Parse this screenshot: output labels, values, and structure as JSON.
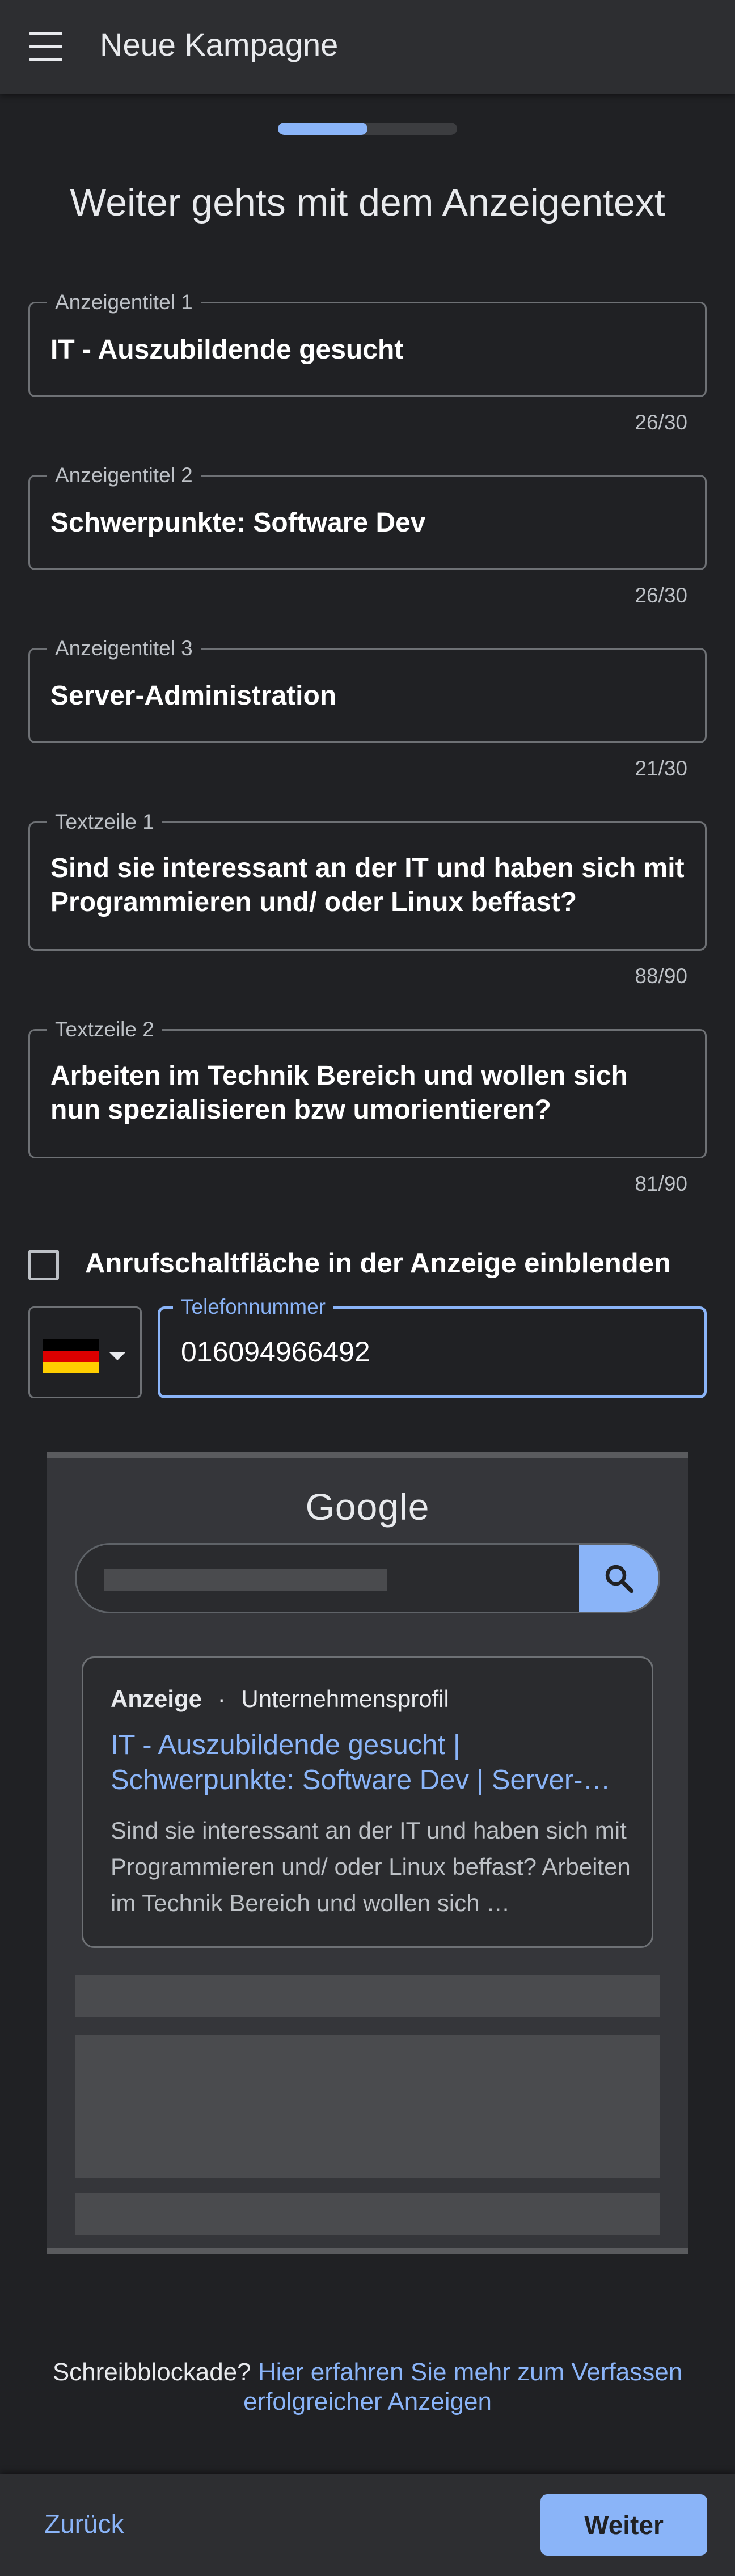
{
  "appbar": {
    "title": "Neue Kampagne",
    "menu_icon": "hamburger-menu-icon"
  },
  "progress": {
    "fraction": 0.5
  },
  "heading": "Weiter gehts mit dem Anzeigentext",
  "fields": [
    {
      "label": "Anzeigentitel 1",
      "value": "IT - Auszubildende gesucht",
      "counter": "26/30"
    },
    {
      "label": "Anzeigentitel 2",
      "value": "Schwerpunkte: Software Dev",
      "counter": "26/30"
    },
    {
      "label": "Anzeigentitel 3",
      "value": "Server-Administration",
      "counter": "21/30"
    },
    {
      "label": "Textzeile 1",
      "value": "Sind sie interessant an der IT und haben sich mit Programmieren und/ oder Linux beffast?",
      "counter": "88/90"
    },
    {
      "label": "Textzeile 2",
      "value": "Arbeiten im Technik Bereich und wollen sich nun spezialisieren bzw umorientieren?",
      "counter": "81/90"
    }
  ],
  "call_button": {
    "label": "Anrufschaltfläche in der Anzeige einblenden",
    "checked": false
  },
  "phone": {
    "country": "DE",
    "label": "Telefonnummer",
    "value": "016094966492"
  },
  "preview": {
    "logo": "Google",
    "search_icon": "search-icon",
    "ad_label": "Anzeige",
    "ad_separator": "·",
    "ad_profile": "Unternehmensprofil",
    "ad_title": "IT - Auszubildende gesucht | Schwerpunkte: Software Dev | Server-…",
    "ad_description": "Sind sie interessant an der IT und haben sich mit Programmieren und/ oder Linux beffast? Arbeiten im Technik Bereich und wollen sich …"
  },
  "footer": {
    "prefix": "Schreibblockade?",
    "link": "Hier erfahren Sie mehr zum Verfassen erfolgreicher Anzeigen"
  },
  "nav": {
    "back": "Zurück",
    "next": "Weiter"
  },
  "colors": {
    "accent": "#8ab4f8",
    "background": "#202124",
    "surface": "#2d2e31"
  }
}
